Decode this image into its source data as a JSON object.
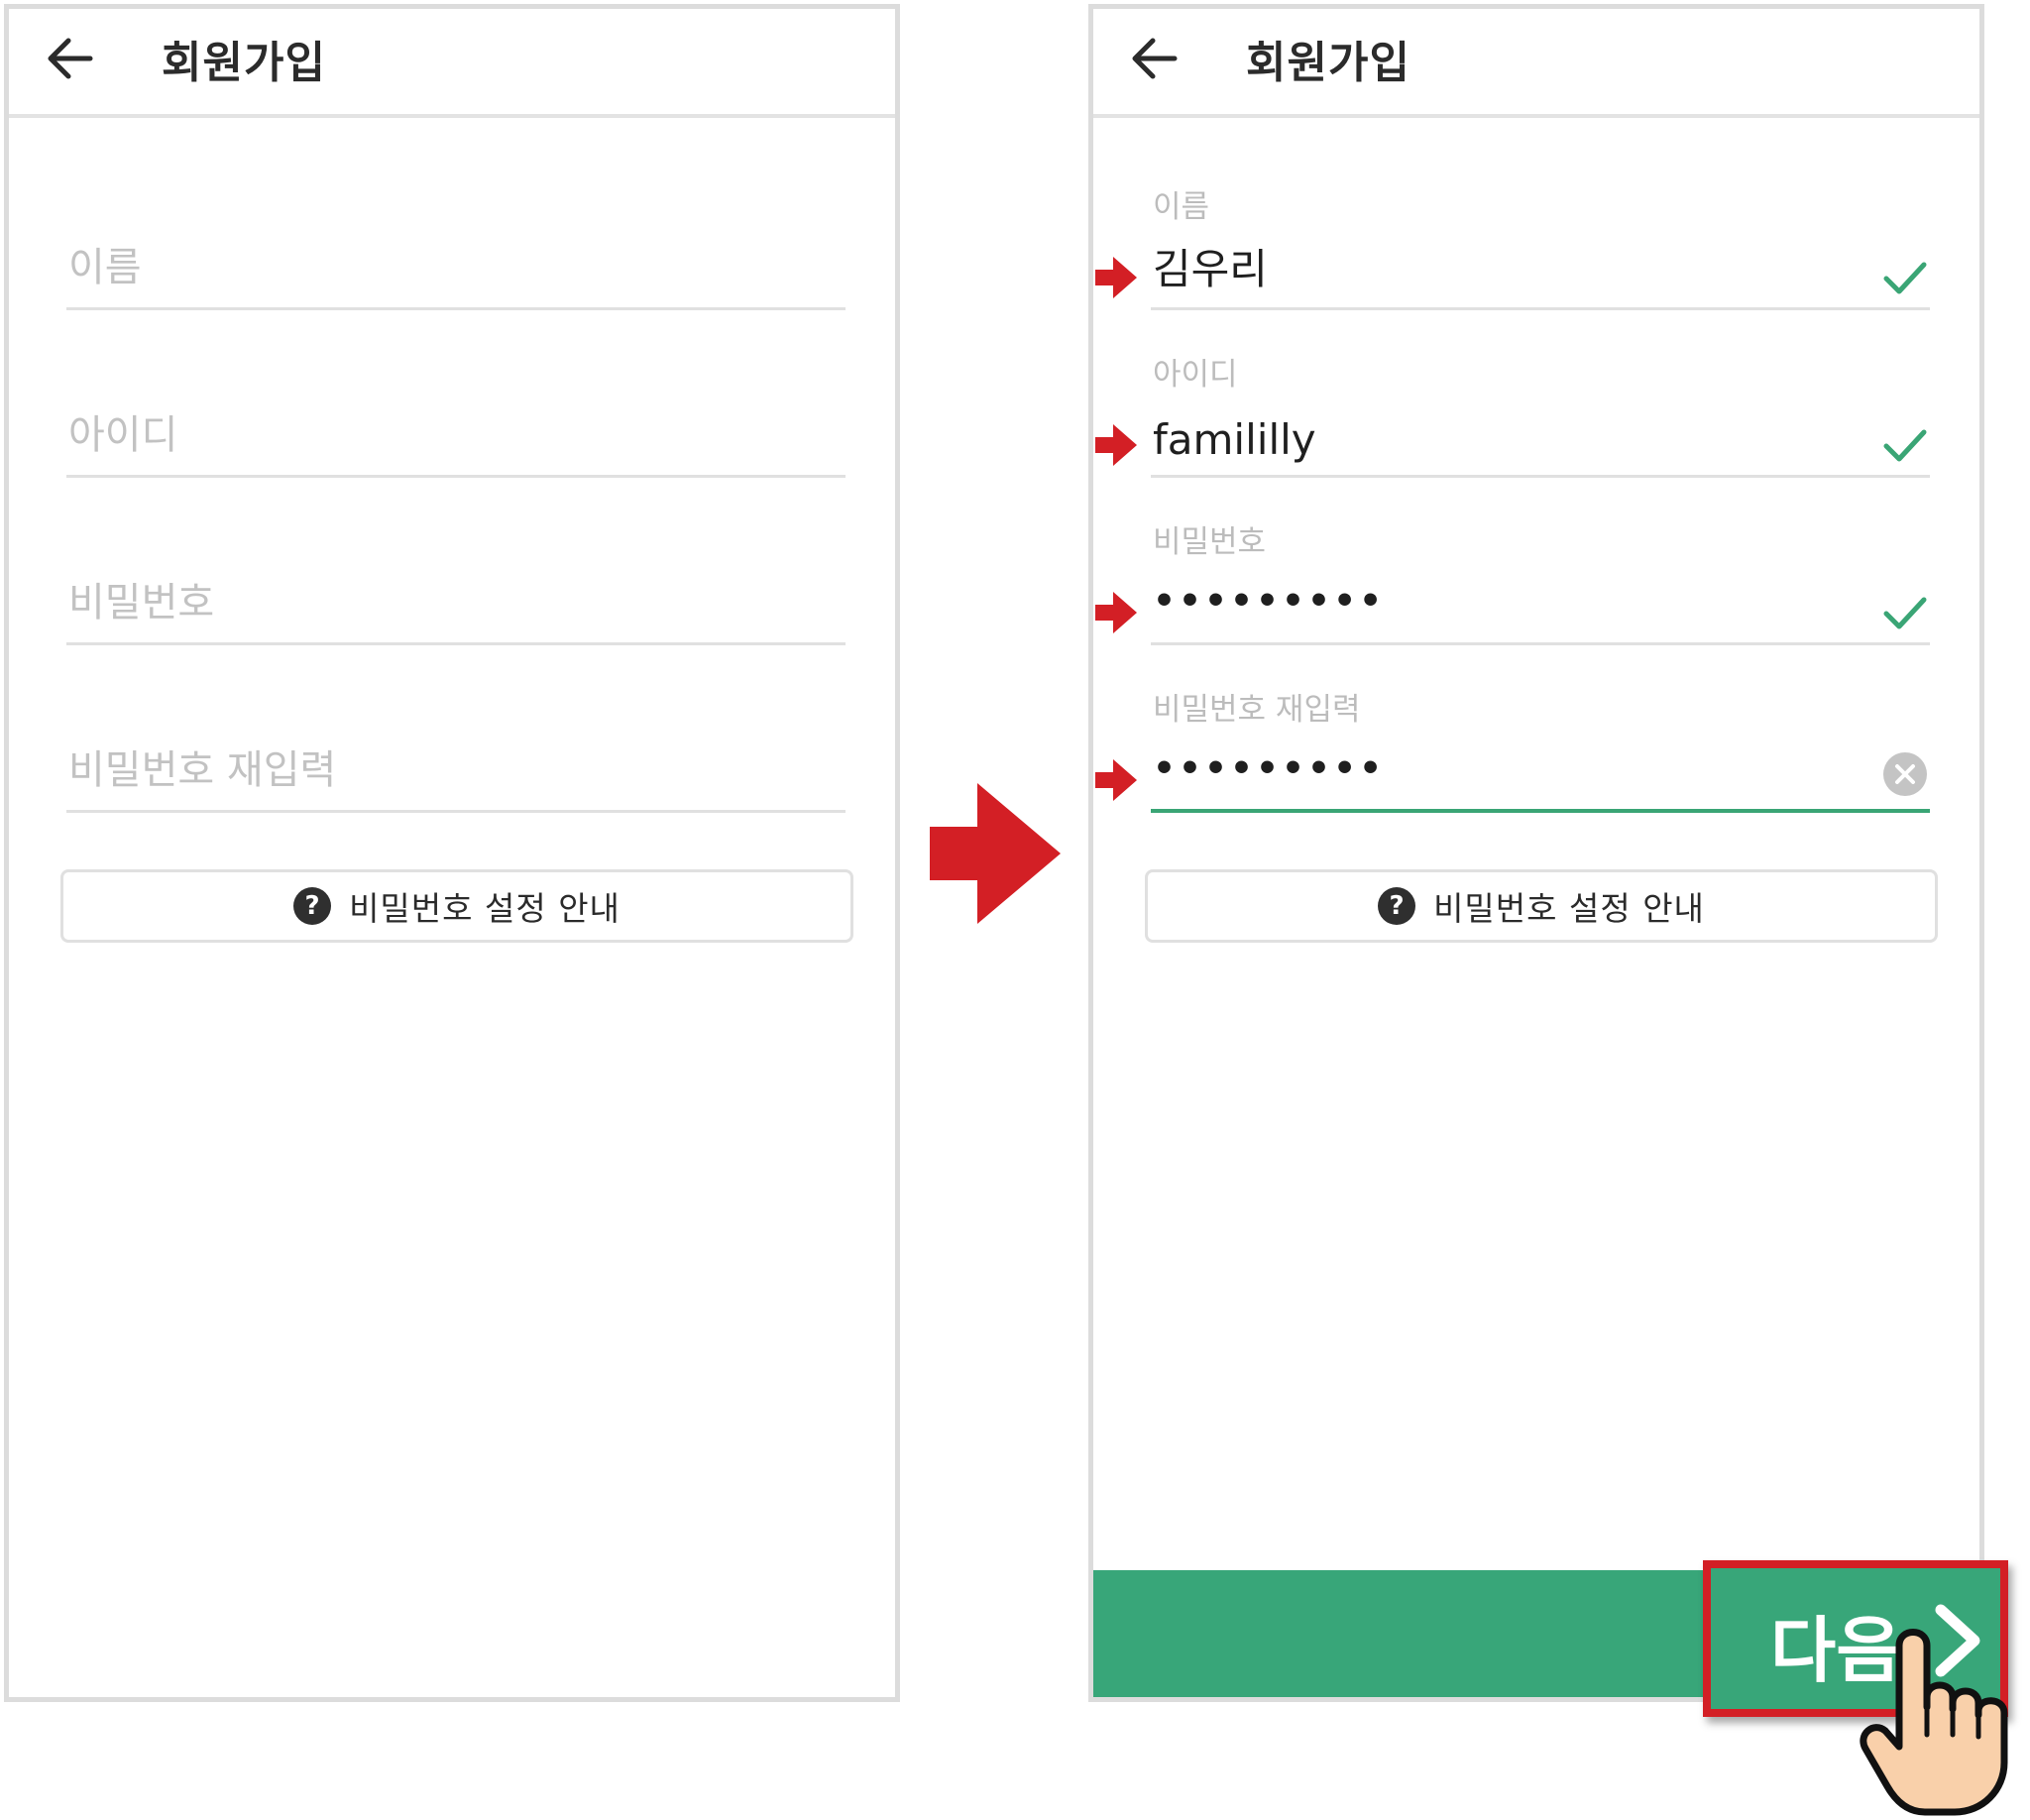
{
  "left_screen": {
    "title": "회원가입",
    "fields": [
      {
        "placeholder": "이름"
      },
      {
        "placeholder": "아이디"
      },
      {
        "placeholder": "비밀번호"
      },
      {
        "placeholder": "비밀번호 재입력"
      }
    ],
    "guide_button": {
      "label": "비밀번호 설정 안내",
      "icon": "?"
    }
  },
  "right_screen": {
    "title": "회원가입",
    "fields": [
      {
        "label": "이름",
        "value": "김우리",
        "status": "check"
      },
      {
        "label": "아이디",
        "value": "famililly",
        "status": "check"
      },
      {
        "label": "비밀번호",
        "value": "•••••••••",
        "status": "check"
      },
      {
        "label": "비밀번호 재입력",
        "value": "•••••••••",
        "status": "clear"
      }
    ],
    "guide_button": {
      "label": "비밀번호 설정 안내",
      "icon": "?"
    },
    "next_button": {
      "label": "다음"
    }
  },
  "colors": {
    "accent_green": "#38a679",
    "highlight_red": "#d31f25"
  }
}
